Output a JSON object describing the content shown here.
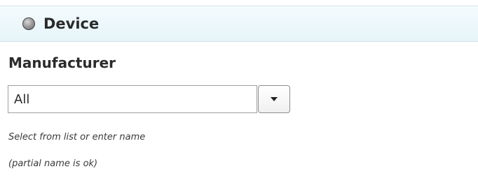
{
  "section": {
    "title": "Device",
    "status_icon": "status-dot-icon"
  },
  "manufacturer": {
    "label": "Manufacturer",
    "value": "All",
    "dropdown_icon": "chevron-down-icon",
    "hint_line1": "Select from list or enter name",
    "hint_line2": "(partial name is ok)"
  }
}
